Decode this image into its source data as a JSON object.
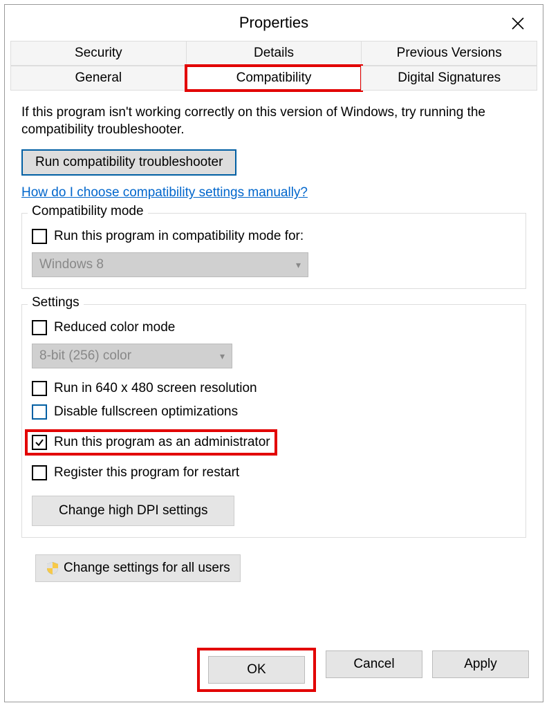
{
  "title": "Properties",
  "tabs": {
    "row1": [
      "Security",
      "Details",
      "Previous Versions"
    ],
    "row2": [
      "General",
      "Compatibility",
      "Digital Signatures"
    ],
    "active": "Compatibility"
  },
  "intro": "If this program isn't working correctly on this version of Windows, try running the compatibility troubleshooter.",
  "run_troubleshooter": "Run compatibility troubleshooter",
  "help_link": "How do I choose compatibility settings manually?",
  "compat_mode": {
    "title": "Compatibility mode",
    "checkbox_label": "Run this program in compatibility mode for:",
    "select_value": "Windows 8"
  },
  "settings": {
    "title": "Settings",
    "reduced_color": "Reduced color mode",
    "color_select": "8-bit (256) color",
    "run640": "Run in 640 x 480 screen resolution",
    "disable_fullscreen": "Disable fullscreen optimizations",
    "run_admin": "Run this program as an administrator",
    "register_restart": "Register this program for restart",
    "dpi_button": "Change high DPI settings"
  },
  "all_users_button": "Change settings for all users",
  "footer": {
    "ok": "OK",
    "cancel": "Cancel",
    "apply": "Apply"
  }
}
